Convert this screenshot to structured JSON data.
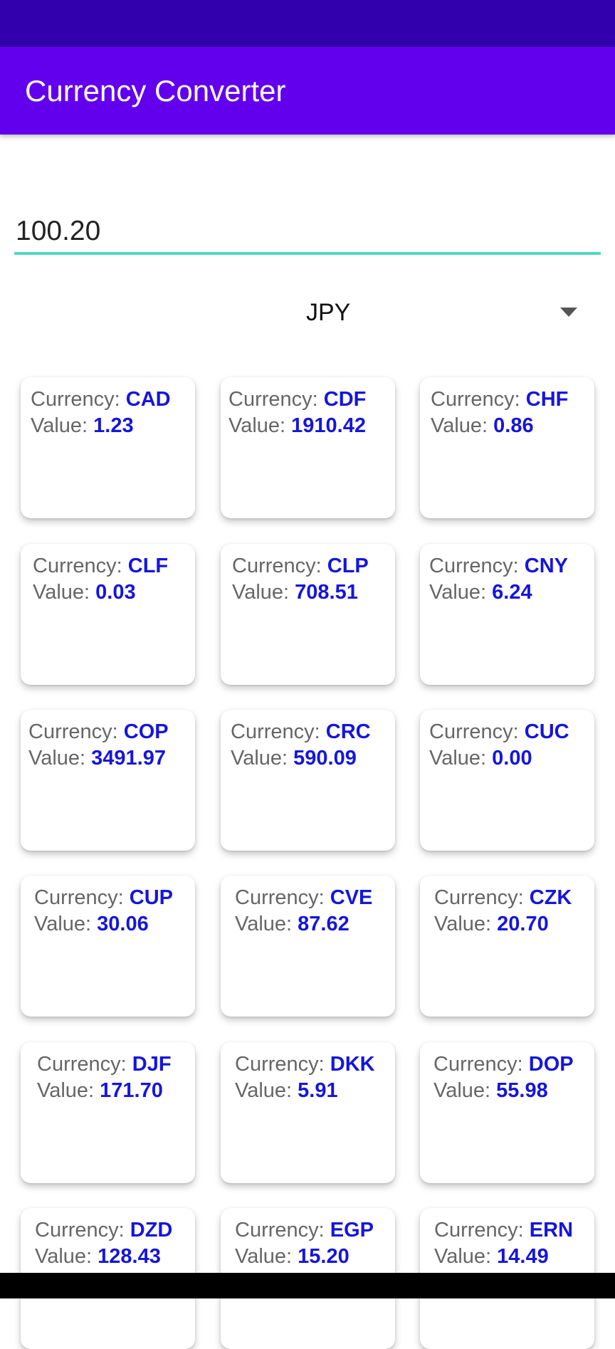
{
  "app": {
    "title": "Currency Converter"
  },
  "colors": {
    "status_bar": "#3200ac",
    "app_bar": "#6200ee",
    "input_underline": "#4fd8c4",
    "value_text": "#1515dd"
  },
  "amount": {
    "value": "100.20"
  },
  "base_currency": {
    "selected": "JPY",
    "icon": "dropdown-arrow-icon"
  },
  "labels": {
    "currency": "Currency: ",
    "value": "Value: "
  },
  "rates": [
    {
      "code": "CAD",
      "value": "1.23"
    },
    {
      "code": "CDF",
      "value": "1910.42"
    },
    {
      "code": "CHF",
      "value": "0.86"
    },
    {
      "code": "CLF",
      "value": "0.03"
    },
    {
      "code": "CLP",
      "value": "708.51"
    },
    {
      "code": "CNY",
      "value": "6.24"
    },
    {
      "code": "COP",
      "value": "3491.97"
    },
    {
      "code": "CRC",
      "value": "590.09"
    },
    {
      "code": "CUC",
      "value": "0.00"
    },
    {
      "code": "CUP",
      "value": "30.06"
    },
    {
      "code": "CVE",
      "value": "87.62"
    },
    {
      "code": "CZK",
      "value": "20.70"
    },
    {
      "code": "DJF",
      "value": "171.70"
    },
    {
      "code": "DKK",
      "value": "5.91"
    },
    {
      "code": "DOP",
      "value": "55.98"
    },
    {
      "code": "DZD",
      "value": "128.43"
    },
    {
      "code": "EGP",
      "value": "15.20"
    },
    {
      "code": "ERN",
      "value": "14.49"
    }
  ]
}
